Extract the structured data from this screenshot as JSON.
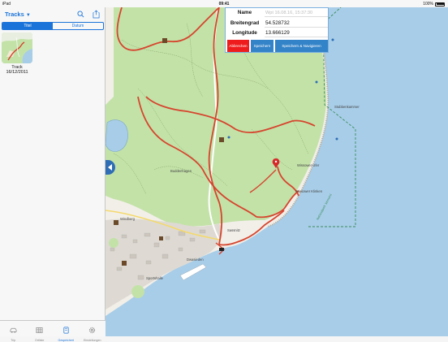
{
  "status_bar": {
    "device": "iPad",
    "time": "09:41",
    "battery": "100%"
  },
  "sidebar": {
    "title": "Tracks",
    "caret": "▼",
    "segments": [
      {
        "label": "Titel",
        "active": true
      },
      {
        "label": "Datum",
        "active": false
      }
    ],
    "tracks": [
      {
        "name": "Track",
        "date": "16/12/2011"
      }
    ]
  },
  "tabbar": [
    {
      "label": "Trip",
      "icon": "car-icon",
      "active": false
    },
    {
      "label": "Ortliste",
      "icon": "grid-icon",
      "active": false
    },
    {
      "label": "Gespeichert",
      "icon": "saved-icon",
      "active": true
    },
    {
      "label": "Einstellungen",
      "icon": "gear-icon",
      "active": false
    }
  ],
  "dialog": {
    "name_label": "Name",
    "name_placeholder": "Wpt 16.08.16, 15:37:30",
    "lat_label": "Breitengrad",
    "lat_value": "54.528732",
    "lon_label": "Longitude",
    "lon_value": "13.666129",
    "cancel_label": "Abbrechen",
    "save_label": "Speichern",
    "save_nav_label": "Speichern & Navigieren"
  },
  "map_labels": {
    "place_1": "Buddenhagen",
    "place_2": "Windberg",
    "place_3": "Wissower Ufer",
    "place_4": "Wissower Klinken",
    "place_5": "Sportshalle",
    "place_6": "Sassnitz",
    "place_7": "Dwasieden",
    "place_8": "Nationalpark Jasmund",
    "place_9": "Stubbenkammer"
  },
  "colors": {
    "accent": "#1a73d9",
    "forest": "#c3e2a8",
    "sea": "#a8cde8",
    "track": "#d6452e",
    "cancel": "#ee1c1c",
    "button": "#3383c8"
  }
}
